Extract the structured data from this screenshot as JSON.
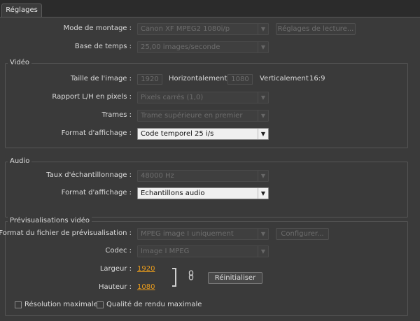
{
  "tab": {
    "label": "Réglages"
  },
  "general": {
    "mode_label": "Mode de montage :",
    "mode_value": "Canon XF MPEG2 1080i/p",
    "playback_button": "Réglages de lecture...",
    "timebase_label": "Base de temps :",
    "timebase_value": "25,00 images/seconde"
  },
  "video": {
    "title": "Vidéo",
    "frame_size_label": "Taille de l'image :",
    "width_value": "1920",
    "horizontal_label": "Horizontalement",
    "height_value": "1080",
    "vertical_label": "Verticalement",
    "aspect": "16:9",
    "pixel_ratio_label": "Rapport L/H en pixels :",
    "pixel_ratio_value": "Pixels carrés (1,0)",
    "fields_label": "Trames :",
    "fields_value": "Trame supérieure en premier",
    "display_label": "Format d'affichage :",
    "display_value": "Code temporel 25 i/s"
  },
  "audio": {
    "title": "Audio",
    "sample_rate_label": "Taux d'échantillonnage :",
    "sample_rate_value": "48000 Hz",
    "display_label": "Format d'affichage :",
    "display_value": "Echantillons audio"
  },
  "preview": {
    "title": "Prévisualisations vidéo",
    "file_format_label": "Format du fichier de prévisualisation :",
    "file_format_value": "MPEG image I uniquement",
    "configure_button": "Configurer...",
    "codec_label": "Codec :",
    "codec_value": "Image I MPEG",
    "width_label": "Largeur :",
    "width_value": "1920",
    "height_label": "Hauteur :",
    "height_value": "1080",
    "reset_button": "Réinitialiser",
    "max_res_label": "Résolution maximale",
    "max_quality_label": "Qualité de rendu maximale"
  }
}
